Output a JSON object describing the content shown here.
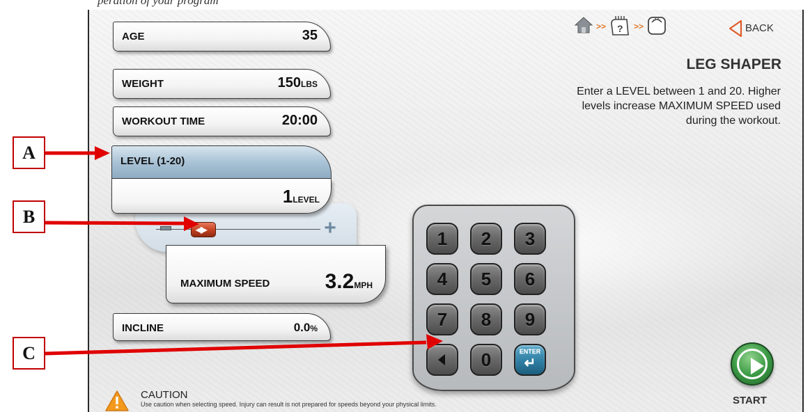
{
  "top_text": "peration of your program",
  "fields": {
    "age": {
      "label": "AGE",
      "value": "35"
    },
    "weight": {
      "label": "WEIGHT",
      "value": "150",
      "unit": "LBS"
    },
    "workout_time": {
      "label": "WORKOUT TIME",
      "value": "20:00"
    },
    "level": {
      "label": "LEVEL (1-20)",
      "value": "1",
      "unit": "LEVEL"
    },
    "max_speed": {
      "label": "MAXIMUM SPEED",
      "value": "3.2",
      "unit": "MPH"
    },
    "incline": {
      "label": "INCLINE",
      "value": "0.0",
      "unit": "%"
    }
  },
  "slider": {
    "level_fraction": 0.0,
    "minus_icon": "minus-icon",
    "plus_icon": "plus-icon"
  },
  "keypad": {
    "keys": [
      "1",
      "2",
      "3",
      "4",
      "5",
      "6",
      "7",
      "8",
      "9",
      "",
      "0",
      ""
    ],
    "enter_label": "ENTER",
    "backspace_icon": "backspace-icon",
    "enter_icon": "enter-arrow-icon"
  },
  "header": {
    "breadcrumb_icons": [
      "home-icon",
      "workout-selection-icon",
      "scale-icon"
    ],
    "breadcrumb_separator": ">>",
    "back_label": "BACK",
    "title": "LEG SHAPER",
    "description": "Enter a LEVEL between 1 and 20. Higher levels increase MAXIMUM SPEED used during the workout."
  },
  "start": {
    "label": "START"
  },
  "caution": {
    "title": "CAUTION",
    "text": "Use caution when selecting speed. Injury can result is not prepared for speeds beyond your physical limits."
  },
  "callouts": [
    "A",
    "B",
    "C"
  ],
  "colors": {
    "callout_red": "#e00000",
    "level_header_blue": "#a9c3d6",
    "slider_thumb": "#c2401f",
    "start_green": "#3c9b45",
    "enter_blue": "#2f7ea3",
    "breadcrumb_orange": "#e07a2b"
  }
}
